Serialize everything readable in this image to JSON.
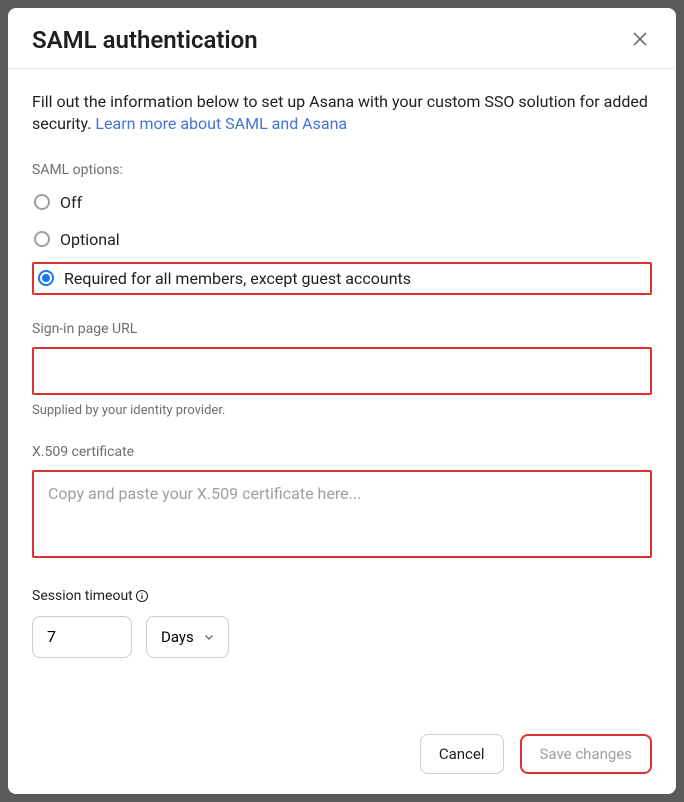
{
  "modal": {
    "title": "SAML authentication",
    "intro_text": "Fill out the information below to set up Asana with your custom SSO solution for added security. ",
    "learn_more_label": "Learn more about SAML and Asana"
  },
  "options": {
    "label": "SAML options:",
    "off": "Off",
    "optional": "Optional",
    "required": "Required for all members, except guest accounts",
    "selected": "required"
  },
  "signin_url": {
    "label": "Sign-in page URL",
    "value": "",
    "help": "Supplied by your identity provider."
  },
  "cert": {
    "label": "X.509 certificate",
    "placeholder": "Copy and paste your X.509 certificate here...",
    "value": ""
  },
  "timeout": {
    "label": "Session timeout",
    "value": "7",
    "unit": "Days"
  },
  "footer": {
    "cancel": "Cancel",
    "save": "Save changes"
  }
}
